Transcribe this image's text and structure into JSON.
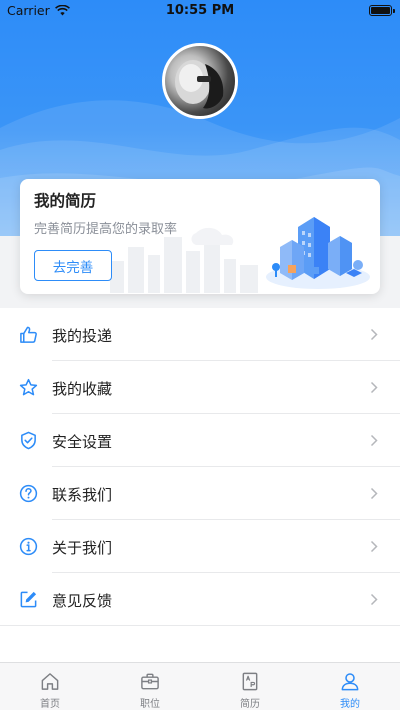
{
  "status_bar": {
    "carrier": "Carrier",
    "time": "10:55 PM",
    "battery_level": 1.0
  },
  "resume_card": {
    "title": "我的简历",
    "subtitle": "完善简历提高您的录取率",
    "button_label": "去完善"
  },
  "menu": [
    {
      "label": "我的投递",
      "icon": "thumbs-up-icon"
    },
    {
      "label": "我的收藏",
      "icon": "star-icon"
    },
    {
      "label": "安全设置",
      "icon": "shield-check-icon"
    },
    {
      "label": "联系我们",
      "icon": "question-circle-icon"
    },
    {
      "label": "关于我们",
      "icon": "info-circle-icon"
    },
    {
      "label": "意见反馈",
      "icon": "edit-icon"
    }
  ],
  "tabs": [
    {
      "label": "首页",
      "icon": "home-icon",
      "active": false
    },
    {
      "label": "职位",
      "icon": "briefcase-icon",
      "active": false
    },
    {
      "label": "简历",
      "icon": "resume-icon",
      "active": false
    },
    {
      "label": "我的",
      "icon": "person-icon",
      "active": true
    }
  ],
  "colors": {
    "accent": "#2d8cf8",
    "header_top": "#2d8cf8",
    "header_bottom": "#73b4f8",
    "tab_inactive": "#7d7f84",
    "text": "#222222",
    "subtitle": "#8a8f98"
  }
}
